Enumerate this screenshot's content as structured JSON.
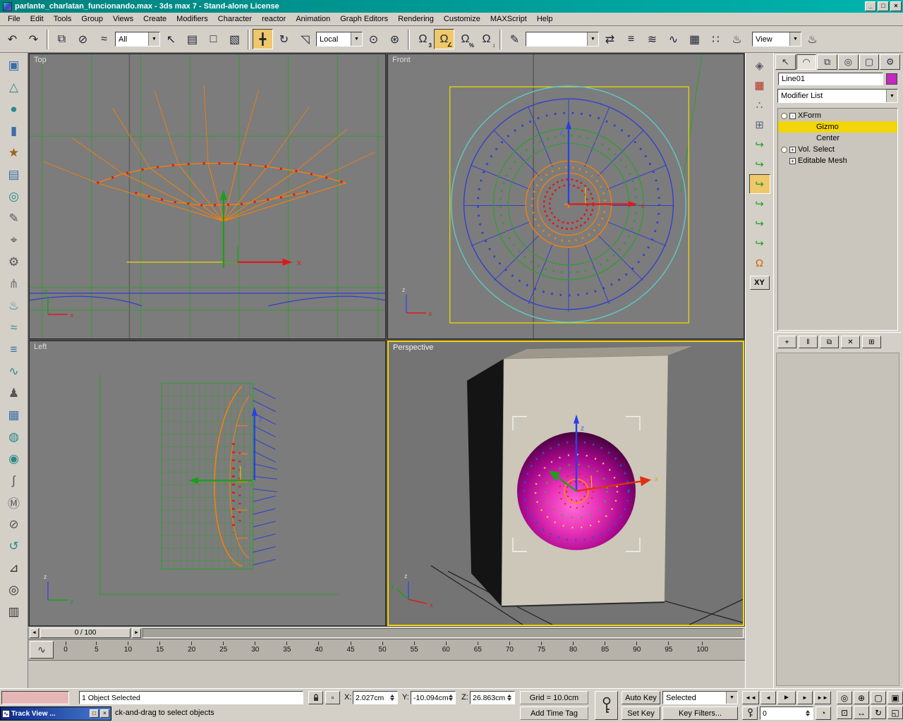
{
  "window": {
    "title": "parlante_charlatan_funcionando.max - 3ds max 7 - Stand-alone License",
    "controls": {
      "minimize": "_",
      "maximize": "□",
      "close": "×"
    }
  },
  "ui": {
    "dropdown_arrow": "▼",
    "accent_yellow": "#f2d50a",
    "titlebar_teal": "#00a39e",
    "panel_gray": "#d4d0c8",
    "viewport_gray": "#7c7c7c"
  },
  "menubar": {
    "items": [
      {
        "name": "menu-file",
        "label": "File"
      },
      {
        "name": "menu-edit",
        "label": "Edit"
      },
      {
        "name": "menu-tools",
        "label": "Tools"
      },
      {
        "name": "menu-group",
        "label": "Group"
      },
      {
        "name": "menu-views",
        "label": "Views"
      },
      {
        "name": "menu-create",
        "label": "Create"
      },
      {
        "name": "menu-modifiers",
        "label": "Modifiers"
      },
      {
        "name": "menu-character",
        "label": "Character"
      },
      {
        "name": "menu-reactor",
        "label": "reactor"
      },
      {
        "name": "menu-animation",
        "label": "Animation"
      },
      {
        "name": "menu-graph-editors",
        "label": "Graph Editors"
      },
      {
        "name": "menu-rendering",
        "label": "Rendering"
      },
      {
        "name": "menu-customize",
        "label": "Customize"
      },
      {
        "name": "menu-maxscript",
        "label": "MAXScript"
      },
      {
        "name": "menu-help",
        "label": "Help"
      }
    ]
  },
  "toolbar": {
    "undo_glyph": "↶",
    "redo_glyph": "↷",
    "link_glyph": "⧉",
    "unlink_glyph": "⊘",
    "bind_glyph": "≈",
    "filter_value": "All",
    "select_glyph": "↖",
    "byname_glyph": "▤",
    "region_glyph": "□",
    "wincross_glyph": "▧",
    "move_glyph": "╋",
    "rotate_glyph": "↻",
    "scale_glyph": "◹",
    "coordsys_value": "Local",
    "center_glyph": "⊙",
    "manip_glyph": "⊛",
    "snap_glyph": "Ω",
    "snap3_badge": "3",
    "anglesnap_badge": "∠",
    "percentsnap_badge": "%",
    "spinnersnap_badge": "↕",
    "namedsets_glyph": "✎",
    "named_selection_value": "",
    "mirror_glyph": "⇄",
    "align_glyph": "≡",
    "layers_glyph": "≋",
    "curve_glyph": "∿",
    "schematic_glyph": "▦",
    "material_glyph": "∷",
    "render_glyph": "♨",
    "render_type_value": "View",
    "quickrender_glyph": "♨"
  },
  "left_toolbar": {
    "icons": [
      {
        "name": "box-primitive-icon",
        "glyph": "▣"
      },
      {
        "name": "cone-primitive-icon",
        "glyph": "△",
        "color": "#2a8a8a"
      },
      {
        "name": "sphere-primitive-icon",
        "glyph": "●",
        "color": "#2a8a8a"
      },
      {
        "name": "cylinder-primitive-icon",
        "glyph": "▮"
      },
      {
        "name": "star-shape-icon",
        "glyph": "★",
        "color": "#a06020"
      },
      {
        "name": "image-plane-icon",
        "glyph": "▤"
      },
      {
        "name": "torus-icon",
        "glyph": "◎",
        "color": "#2a8a8a"
      },
      {
        "name": "pencil-tool-icon",
        "glyph": "✎",
        "color": "#555"
      },
      {
        "name": "magnify-tool-icon",
        "glyph": "⌖",
        "color": "#555"
      },
      {
        "name": "gear-tool-icon",
        "glyph": "⚙",
        "color": "#555"
      },
      {
        "name": "fork-tool-icon",
        "glyph": "⋔",
        "color": "#777"
      },
      {
        "name": "teapot-icon",
        "glyph": "♨",
        "color": "#2a8a8a"
      },
      {
        "name": "waves-icon",
        "glyph": "≈",
        "color": "#2a8a8a"
      },
      {
        "name": "stack-lines-icon",
        "glyph": "≡"
      },
      {
        "name": "spring-icon",
        "glyph": "∿",
        "color": "#2a8a8a"
      },
      {
        "name": "figure-icon",
        "glyph": "♟",
        "color": "#555"
      },
      {
        "name": "panel-grid-icon",
        "glyph": "▦"
      },
      {
        "name": "globe-icon",
        "glyph": "◍",
        "color": "#2a8a8a"
      },
      {
        "name": "droplet-icon",
        "glyph": "◉",
        "color": "#2a8a8a"
      },
      {
        "name": "curve-s-icon",
        "glyph": "∫",
        "color": "#555"
      },
      {
        "name": "m-badge-icon",
        "glyph": "Ⓜ",
        "color": "#555"
      },
      {
        "name": "null-object-icon",
        "glyph": "⊘",
        "color": "#555"
      },
      {
        "name": "spiral-icon",
        "glyph": "↺",
        "color": "#2a8a8a"
      },
      {
        "name": "chart-icon",
        "glyph": "⊿",
        "color": "#333"
      },
      {
        "name": "target-icon",
        "glyph": "◎",
        "color": "#333"
      },
      {
        "name": "film-strip-icon",
        "glyph": "▥",
        "color": "#333"
      }
    ]
  },
  "right_toolbar": {
    "icons": [
      {
        "name": "gyroscope-icon",
        "glyph": "◈",
        "color": "#556"
      },
      {
        "name": "bricks-icon",
        "glyph": "▦",
        "color": "#b03020"
      },
      {
        "name": "spray-icon",
        "glyph": "∴",
        "color": "#566"
      },
      {
        "name": "lattice-icon",
        "glyph": "⊞",
        "color": "#567"
      },
      {
        "name": "spacewarp-hook-icon-1",
        "glyph": "↪",
        "color": "#2a9a2a"
      },
      {
        "name": "spacewarp-hook-icon-2",
        "glyph": "↪",
        "color": "#2a9a2a"
      },
      {
        "name": "spacewarp-hook-icon-3",
        "glyph": "↪",
        "color": "#2a9a2a",
        "active": true
      },
      {
        "name": "spacewarp-hook-icon-4",
        "glyph": "↪",
        "color": "#2a9a2a"
      },
      {
        "name": "spacewarp-hook-icon-5",
        "glyph": "↪",
        "color": "#2a9a2a"
      },
      {
        "name": "spacewarp-hook-icon-6",
        "glyph": "↪",
        "color": "#2a9a2a"
      },
      {
        "name": "magnet-snap-icon",
        "glyph": "Ω",
        "color": "#cc6600"
      }
    ],
    "xy_label": "XY"
  },
  "viewports": {
    "top": {
      "label": "Top"
    },
    "front": {
      "label": "Front"
    },
    "left": {
      "label": "Left"
    },
    "perspective": {
      "label": "Perspective"
    },
    "axis_x": "x",
    "axis_y": "y",
    "axis_z": "z",
    "gizmo_x": "X"
  },
  "timeline": {
    "slider_label": "0 / 100",
    "left_arrow": "◄",
    "right_arrow": "►",
    "curve_button_glyph": "∿",
    "ruler_ticks": [
      "0",
      "5",
      "10",
      "15",
      "20",
      "25",
      "30",
      "35",
      "40",
      "45",
      "50",
      "55",
      "60",
      "65",
      "70",
      "75",
      "80",
      "85",
      "90",
      "95",
      "100"
    ]
  },
  "command_panel": {
    "tabs": [
      {
        "name": "tab-create",
        "glyph": "↖"
      },
      {
        "name": "tab-modify",
        "glyph": "◠",
        "active": true
      },
      {
        "name": "tab-hierarchy",
        "glyph": "⧉"
      },
      {
        "name": "tab-motion",
        "glyph": "◎"
      },
      {
        "name": "tab-display",
        "glyph": "▢"
      },
      {
        "name": "tab-utilities",
        "glyph": "⚙"
      }
    ],
    "object_name": "Line01",
    "modifier_list_label": "Modifier List",
    "stack": [
      {
        "name": "stack-xform",
        "label": "XForm",
        "bulb": true,
        "expander": "-"
      },
      {
        "name": "stack-gizmo",
        "label": "Gizmo",
        "indent": true,
        "selected": true
      },
      {
        "name": "stack-center",
        "label": "Center",
        "indent": true
      },
      {
        "name": "stack-vol-select",
        "label": "Vol. Select",
        "bulb": true,
        "expander": "+"
      },
      {
        "name": "stack-editable-mesh",
        "label": "Editable Mesh",
        "expander": "+"
      }
    ],
    "stack_buttons": [
      {
        "name": "pin-stack-button",
        "glyph": "⌖"
      },
      {
        "name": "show-end-result-button",
        "glyph": "‖"
      },
      {
        "name": "make-unique-button",
        "glyph": "⧉"
      },
      {
        "name": "remove-modifier-button",
        "glyph": "✕"
      },
      {
        "name": "configure-modifier-sets-button",
        "glyph": "⊞"
      }
    ]
  },
  "statusbar": {
    "selection_status": "1 Object Selected",
    "prompt": "ck-and-drag to select objects",
    "abs_offset_glyph": "▫",
    "x_label": "X:",
    "x_value": "2.027cm",
    "y_label": "Y:",
    "y_value": "-10.094cm",
    "z_label": "Z:",
    "z_value": "26.863cm",
    "grid_label": "Grid = 10.0cm",
    "add_time_tag": "Add Time Tag",
    "auto_key": "Auto Key",
    "set_key": "Set Key",
    "selected_dropdown": "Selected",
    "key_filters": "Key Filters...",
    "frame_value": "0",
    "time_config_glyph": "◔",
    "playback": {
      "start": "◄◄",
      "prev": "◄",
      "play": "►",
      "next": "►",
      "end": "►►"
    },
    "nav": [
      {
        "name": "zoom-button",
        "glyph": "◎"
      },
      {
        "name": "zoom-all-button",
        "glyph": "⊕"
      },
      {
        "name": "zoom-extents-button",
        "glyph": "▢"
      },
      {
        "name": "zoom-extents-all-button",
        "glyph": "▣"
      },
      {
        "name": "region-zoom-button",
        "glyph": "⊡"
      },
      {
        "name": "pan-button",
        "glyph": "↔"
      },
      {
        "name": "arc-rotate-button",
        "glyph": "↻"
      },
      {
        "name": "min-max-toggle-button",
        "glyph": "◱"
      }
    ]
  },
  "trackview": {
    "title": "Track View ...",
    "icon_glyph": "∿",
    "restore_button": "□",
    "close_button": "×"
  }
}
